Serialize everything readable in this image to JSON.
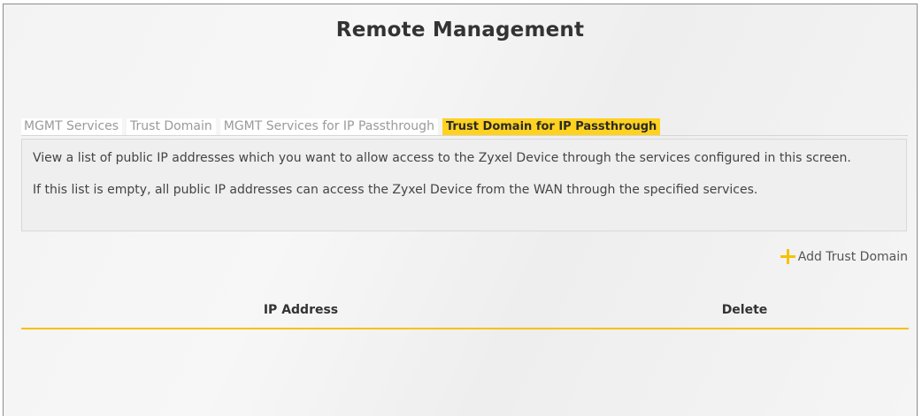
{
  "page": {
    "title": "Remote Management"
  },
  "tabs": [
    {
      "label": "MGMT Services",
      "active": false
    },
    {
      "label": "Trust Domain",
      "active": false
    },
    {
      "label": "MGMT Services for IP Passthrough",
      "active": false
    },
    {
      "label": "Trust Domain for IP Passthrough",
      "active": true
    }
  ],
  "info": {
    "paragraph1": "View a list of public IP addresses which you want to allow access to the Zyxel Device through the services configured in this screen.",
    "paragraph2": "If this list is empty, all public IP addresses can access the Zyxel Device from the WAN through the specified services."
  },
  "actions": {
    "add_label": "Add Trust Domain",
    "add_icon": "plus-icon"
  },
  "table": {
    "columns": [
      "IP Address",
      "Delete"
    ],
    "rows": []
  },
  "colors": {
    "accent": "#ffd21f",
    "accent_line": "#f6c100"
  }
}
